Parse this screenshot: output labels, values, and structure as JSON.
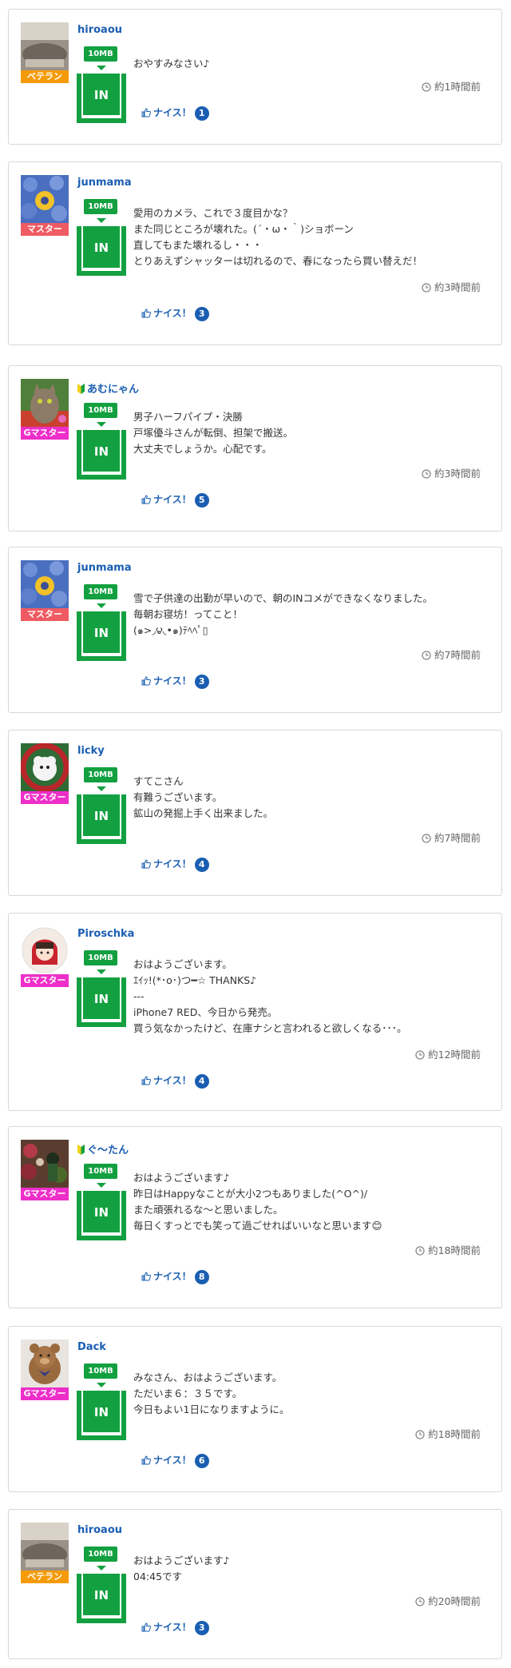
{
  "colors": {
    "username": "#1a5eb2",
    "in_green": "#13a040",
    "rank_veteran": "#f59b0a",
    "rank_master": "#ef5b63",
    "rank_gmaster": "#ee2ec9",
    "nice_badge": "#1a5eb2"
  },
  "icons": [
    "clock-icon",
    "thumbs-up-icon",
    "beginner-mark-icon"
  ],
  "posts": [
    {
      "username": "hiroaou",
      "rank": "ベテラン",
      "size": "10MB",
      "in": "IN",
      "message": "おやすみなさい♪",
      "time": "約1時間前",
      "nice_label": "ナイス！",
      "nice_count": "1"
    },
    {
      "username": "junmama",
      "rank": "マスター",
      "size": "10MB",
      "in": "IN",
      "message": "愛用のカメラ、これで３度目かな？\nまた同じところが壊れた。(´・ω・｀)ショボーン\n直してもまた壊れるし・・・\nとりあえずシャッターは切れるので、春になったら買い替えだ！",
      "time": "約3時間前",
      "nice_label": "ナイス！",
      "nice_count": "3"
    },
    {
      "username": "あむにゃん",
      "rank": "Gマスター",
      "size": "10MB",
      "in": "IN",
      "message": "男子ハーフパイプ・決勝\n戸塚優斗さんが転倒、担架で搬送。\n大丈夫でしょうか。心配です。",
      "time": "約3時間前",
      "nice_label": "ナイス！",
      "nice_count": "5"
    },
    {
      "username": "junmama",
      "rank": "マスター",
      "size": "10MB",
      "in": "IN",
      "message": "雪で子供達の出勤が早いので、朝のINコメができなくなりました。\n毎朝お寝坊！ってこと！\n(๑>◞౪◟•๑)ﾃﾍﾍﾟ▯",
      "time": "約7時間前",
      "nice_label": "ナイス！",
      "nice_count": "3"
    },
    {
      "username": "licky",
      "rank": "Gマスター",
      "size": "10MB",
      "in": "IN",
      "message": "すてこさん\n有難うございます。\n鉱山の発掘上手く出来ました。",
      "time": "約7時間前",
      "nice_label": "ナイス！",
      "nice_count": "4"
    },
    {
      "username": "Piroschka",
      "rank": "Gマスター",
      "size": "10MB",
      "in": "IN",
      "message": "おはようございます。\nｴｲｯ!(*･o･)つ━☆ THANKS♪\n---\niPhone7 RED、今日から発売。\n買う気なかったけど、在庫ナシと言われると欲しくなる･･･。",
      "time": "約12時間前",
      "nice_label": "ナイス！",
      "nice_count": "4"
    },
    {
      "username": "ぐ～たん",
      "rank": "Gマスター",
      "size": "10MB",
      "in": "IN",
      "message": "おはようございます♪\n昨日はHappyなことが大小2つもありました(^O^)/\nまた頑張れるな～と思いました。\n毎日くすっとでも笑って過ごせればいいなと思います😊",
      "time": "約18時間前",
      "nice_label": "ナイス！",
      "nice_count": "8"
    },
    {
      "username": "Dack",
      "rank": "Gマスター",
      "size": "10MB",
      "in": "IN",
      "message": "みなさん、おはようございます。\nただいま６：３５です。\n今日もよい1日になりますように。",
      "time": "約18時間前",
      "nice_label": "ナイス！",
      "nice_count": "6"
    },
    {
      "username": "hiroaou",
      "rank": "ベテラン",
      "size": "10MB",
      "in": "IN",
      "message": "おはようございます♪\n04:45です",
      "time": "約20時間前",
      "nice_label": "ナイス！",
      "nice_count": "3"
    }
  ]
}
